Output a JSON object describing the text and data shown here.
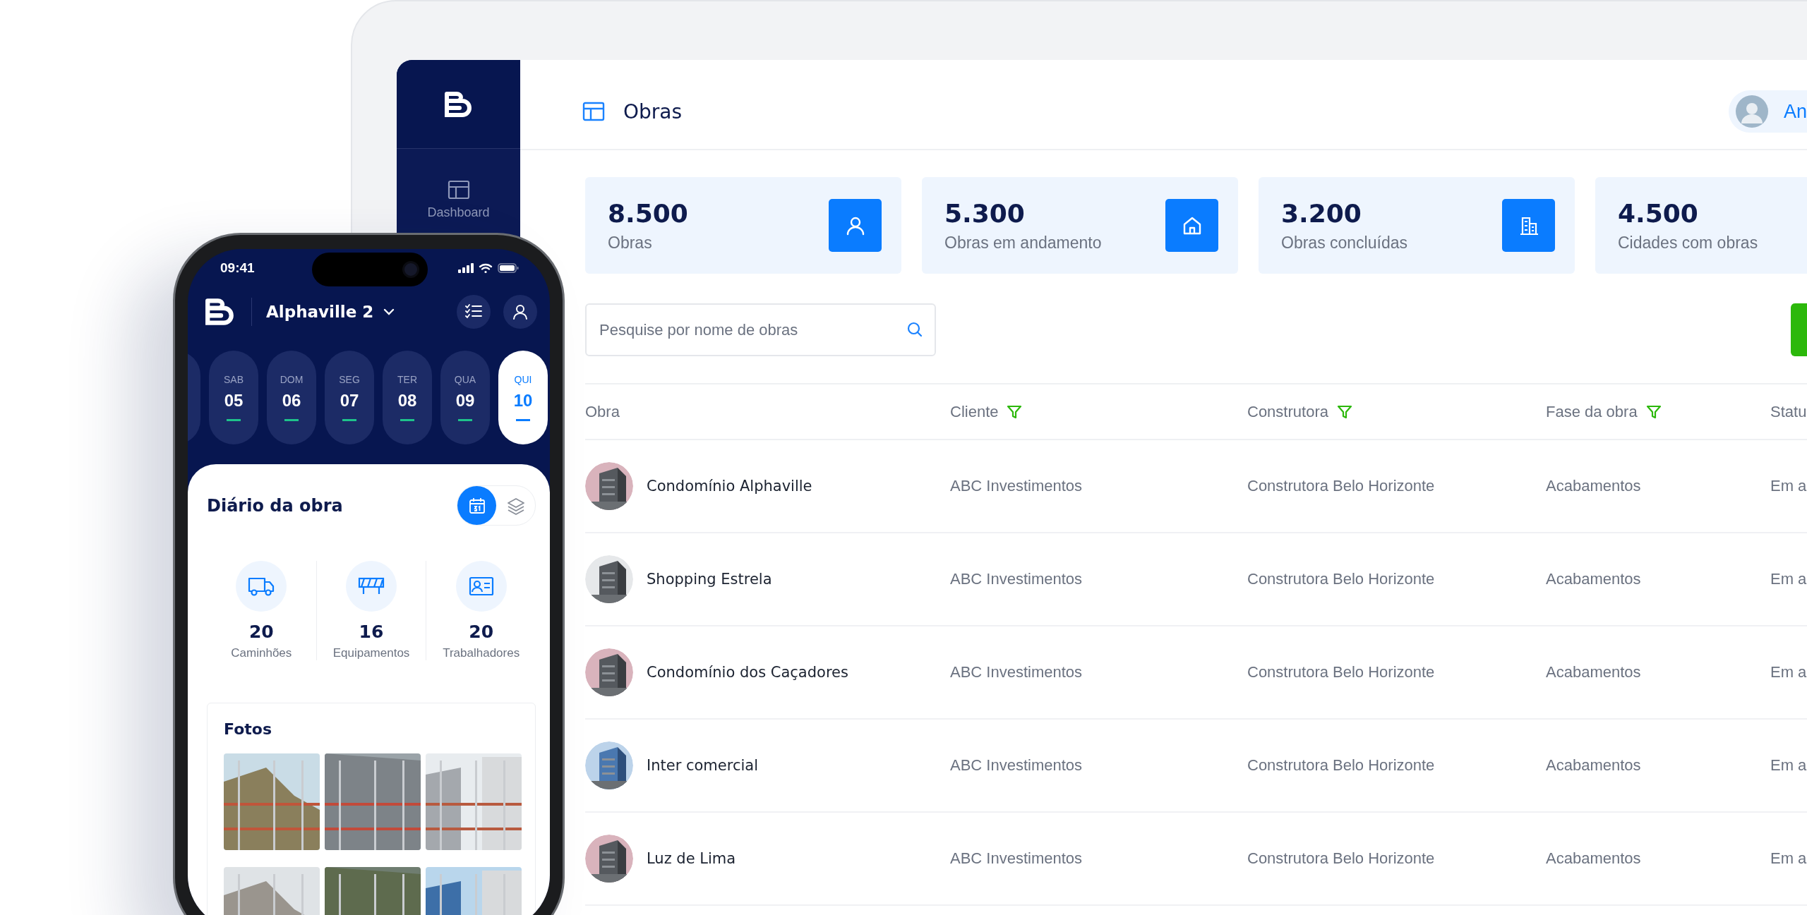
{
  "sidebar": {
    "items": [
      {
        "label": "Dashboard",
        "selected": false
      }
    ]
  },
  "header": {
    "title": "Obras",
    "user": "An"
  },
  "stats": [
    {
      "value": "8.500",
      "label": "Obras"
    },
    {
      "value": "5.300",
      "label": "Obras em andamento"
    },
    {
      "value": "3.200",
      "label": "Obras concluídas"
    },
    {
      "value": "4.500",
      "label": "Cidades com obras"
    }
  ],
  "search": {
    "placeholder": "Pesquise por nome de obras"
  },
  "table": {
    "columns": [
      {
        "label": "Obra",
        "filter": false
      },
      {
        "label": "Cliente",
        "filter": true
      },
      {
        "label": "Construtora",
        "filter": true
      },
      {
        "label": "Fase da obra",
        "filter": true
      },
      {
        "label": "Statu",
        "filter": false
      }
    ],
    "rows": [
      {
        "obra": "Condomínio Alphaville",
        "cliente": "ABC Investimentos",
        "construtora": "Construtora Belo Horizonte",
        "fase": "Acabamentos",
        "status": "Em a"
      },
      {
        "obra": "Shopping Estrela",
        "cliente": "ABC Investimentos",
        "construtora": "Construtora Belo Horizonte",
        "fase": "Acabamentos",
        "status": "Em a"
      },
      {
        "obra": "Condomínio dos Caçadores",
        "cliente": "ABC Investimentos",
        "construtora": "Construtora Belo Horizonte",
        "fase": "Acabamentos",
        "status": "Em a"
      },
      {
        "obra": "Inter comercial",
        "cliente": "ABC Investimentos",
        "construtora": "Construtora Belo Horizonte",
        "fase": "Acabamentos",
        "status": "Em a"
      },
      {
        "obra": "Luz de Lima",
        "cliente": "ABC Investimentos",
        "construtora": "Construtora Belo Horizonte",
        "fase": "Acabamentos",
        "status": "Em a"
      }
    ]
  },
  "phone": {
    "time": "09:41",
    "project": "Alphaville 2",
    "days": [
      {
        "weekday": "SAB",
        "day": "05",
        "selected": false
      },
      {
        "weekday": "DOM",
        "day": "06",
        "selected": false
      },
      {
        "weekday": "SEG",
        "day": "07",
        "selected": false
      },
      {
        "weekday": "TER",
        "day": "08",
        "selected": false
      },
      {
        "weekday": "QUA",
        "day": "09",
        "selected": false
      },
      {
        "weekday": "QUI",
        "day": "10",
        "selected": true
      }
    ],
    "diary": {
      "title": "Diário da obra",
      "views": [
        {
          "selected": true
        },
        {
          "selected": false
        }
      ]
    },
    "counters": [
      {
        "value": "20",
        "label": "Caminhões"
      },
      {
        "value": "16",
        "label": "Equipamentos"
      },
      {
        "value": "20",
        "label": "Trabalhadores"
      }
    ],
    "photos": {
      "title": "Fotos"
    }
  }
}
